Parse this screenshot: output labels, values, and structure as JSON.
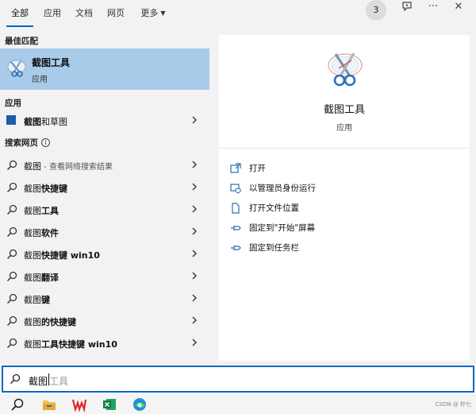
{
  "tabs": [
    {
      "label": "全部",
      "active": true
    },
    {
      "label": "应用"
    },
    {
      "label": "文档"
    },
    {
      "label": "网页"
    },
    {
      "label": "更多"
    }
  ],
  "badge": "3",
  "top_icons": [
    "feedback-icon",
    "more-icon",
    "close-icon"
  ],
  "sections": {
    "best_match": "最佳匹配",
    "apps": "应用",
    "web": "搜索网页"
  },
  "best_match": {
    "title": "截图工具",
    "subtitle": "应用",
    "icon": "snipping-tool-icon"
  },
  "apps": [
    {
      "name_plain": "截图",
      "name_bold": "和草图",
      "icon": "snip-sketch-icon"
    }
  ],
  "web_results": [
    {
      "plain": "截图",
      "bold": "",
      "hint": " - 查看网络搜索结果"
    },
    {
      "plain": "截图",
      "bold": "快捷键",
      "hint": ""
    },
    {
      "plain": "截图",
      "bold": "工具",
      "hint": ""
    },
    {
      "plain": "截图",
      "bold": "软件",
      "hint": ""
    },
    {
      "plain": "截图",
      "bold": "快捷键 win10",
      "hint": ""
    },
    {
      "plain": "截图",
      "bold": "翻译",
      "hint": ""
    },
    {
      "plain": "截图",
      "bold": "键",
      "hint": ""
    },
    {
      "plain": "截图",
      "bold": "的快捷键",
      "hint": ""
    },
    {
      "plain": "截图",
      "bold": "工具快捷键 win10",
      "hint": ""
    }
  ],
  "detail": {
    "title": "截图工具",
    "subtitle": "应用",
    "actions": [
      {
        "label": "打开",
        "icon": "open-icon"
      },
      {
        "label": "以管理员身份运行",
        "icon": "run-as-admin-icon"
      },
      {
        "label": "打开文件位置",
        "icon": "file-location-icon"
      },
      {
        "label": "固定到\"开始\"屏幕",
        "icon": "pin-start-icon"
      },
      {
        "label": "固定到任务栏",
        "icon": "pin-taskbar-icon"
      }
    ]
  },
  "search": {
    "typed": "截图",
    "suggestion": "工具"
  },
  "taskbar": [
    "search-icon",
    "file-explorer-icon",
    "wps-icon",
    "excel-icon",
    "edge-icon"
  ],
  "watermark": "CSDN @ 柠七"
}
